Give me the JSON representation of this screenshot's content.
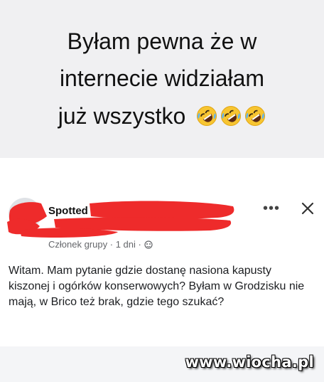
{
  "caption": {
    "line1": "Byłam pewna że w",
    "line2": "internecie widziałam",
    "line3": "już wszystko",
    "emoji": [
      "rolling-laughing-emoji",
      "rolling-laughing-emoji",
      "rolling-laughing-emoji"
    ]
  },
  "post": {
    "group_name": "Spotted",
    "member_role": "Członek grupy",
    "separator": "·",
    "time": "1 dni",
    "separator2": "·",
    "more_label": "•••",
    "text": "Witam. Mam pytanie gdzie dostanę nasiona kapusty kiszonej i ogórków konserwowych? Byłam w Grodzisku nie mają, w Brico też brak, gdzie tego szukać?"
  },
  "watermark": "www.wiocha.pl",
  "colors": {
    "redaction": "#ee2b2b",
    "caption_bg": "#f0f0f2",
    "card_bg": "#ffffff",
    "meta_text": "#65676b"
  }
}
